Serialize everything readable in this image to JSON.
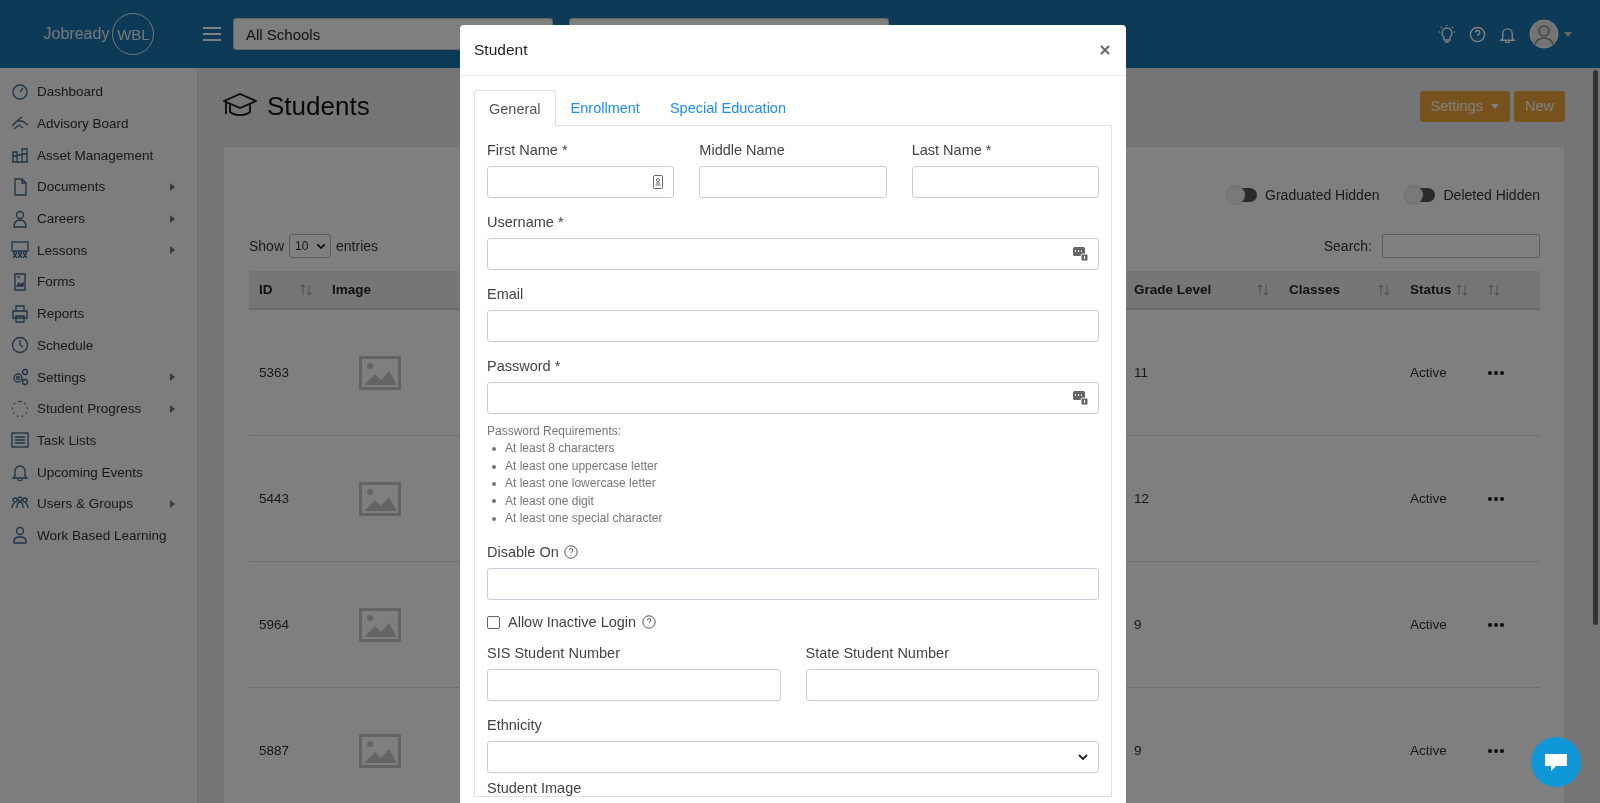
{
  "topbar": {
    "logo": "Jobready",
    "logo_badge": "WBL",
    "school_select": "All Schools"
  },
  "sidebar": {
    "items": [
      {
        "label": "Dashboard",
        "has_submenu": false
      },
      {
        "label": "Advisory Board",
        "has_submenu": false
      },
      {
        "label": "Asset Management",
        "has_submenu": false
      },
      {
        "label": "Documents",
        "has_submenu": true
      },
      {
        "label": "Careers",
        "has_submenu": true
      },
      {
        "label": "Lessons",
        "has_submenu": true
      },
      {
        "label": "Forms",
        "has_submenu": false
      },
      {
        "label": "Reports",
        "has_submenu": false
      },
      {
        "label": "Schedule",
        "has_submenu": false
      },
      {
        "label": "Settings",
        "has_submenu": true
      },
      {
        "label": "Student Progress",
        "has_submenu": true
      },
      {
        "label": "Task Lists",
        "has_submenu": false
      },
      {
        "label": "Upcoming Events",
        "has_submenu": false
      },
      {
        "label": "Users & Groups",
        "has_submenu": true
      },
      {
        "label": "Work Based Learning",
        "has_submenu": false
      }
    ]
  },
  "page": {
    "title": "Students",
    "settings_button": "Settings",
    "new_button": "New"
  },
  "filters": [
    {
      "label": "Graduated Hidden",
      "on": false
    },
    {
      "label": "Deleted Hidden",
      "on": false
    }
  ],
  "table": {
    "show_label": "Show",
    "page_size": "10",
    "entries_label": "entries",
    "search_label": "Search:",
    "columns": [
      {
        "label": "ID",
        "sortable": true
      },
      {
        "label": "Image",
        "sortable": false
      },
      {
        "label": "Grade Level",
        "sortable": true
      },
      {
        "label": "Classes",
        "sortable": true
      },
      {
        "label": "Status",
        "sortable": true
      },
      {
        "sortable": true
      }
    ],
    "rows": [
      {
        "id": "5363",
        "grade": "11",
        "status": "Active"
      },
      {
        "id": "5443",
        "grade": "12",
        "status": "Active"
      },
      {
        "id": "5964",
        "grade": "9",
        "status": "Active"
      },
      {
        "id": "5887",
        "grade": "9",
        "status": "Active"
      }
    ]
  },
  "modal": {
    "title": "Student",
    "tabs": [
      {
        "label": "General",
        "selected": true
      },
      {
        "label": "Enrollment",
        "selected": false
      },
      {
        "label": "Special Education",
        "selected": false
      }
    ],
    "form": [
      {
        "kind": "row",
        "fields": [
          {
            "label": "First Name *",
            "kind": "contact-autofill"
          },
          {
            "label": "Middle Name",
            "kind": "text"
          },
          {
            "label": "Last Name *",
            "kind": "text"
          }
        ]
      },
      {
        "kind": "row",
        "fields": [
          {
            "label": "Username *",
            "kind": "password-autofill"
          }
        ]
      },
      {
        "kind": "row",
        "fields": [
          {
            "label": "Email",
            "kind": "text"
          }
        ]
      },
      {
        "kind": "row",
        "fields": [
          {
            "label": "Password *",
            "kind": "password-autofill"
          }
        ]
      },
      {
        "kind": "requirements",
        "title": "Password Requirements:",
        "items": [
          "At least 8 characters",
          "At least one uppercase letter",
          "At least one lowercase letter",
          "At least one digit",
          "At least one special character"
        ]
      },
      {
        "kind": "row",
        "fields": [
          {
            "label": "Disable On",
            "kind": "text",
            "help": true
          }
        ]
      },
      {
        "kind": "checkbox",
        "label": "Allow Inactive Login",
        "checked": false,
        "help": true
      },
      {
        "kind": "row",
        "fields": [
          {
            "label": "SIS Student Number",
            "kind": "text"
          },
          {
            "label": "State Student Number",
            "kind": "text"
          }
        ]
      },
      {
        "kind": "row",
        "fields": [
          {
            "label": "Ethnicity",
            "kind": "select"
          }
        ]
      },
      {
        "kind": "label",
        "label": "Student Image"
      }
    ]
  }
}
